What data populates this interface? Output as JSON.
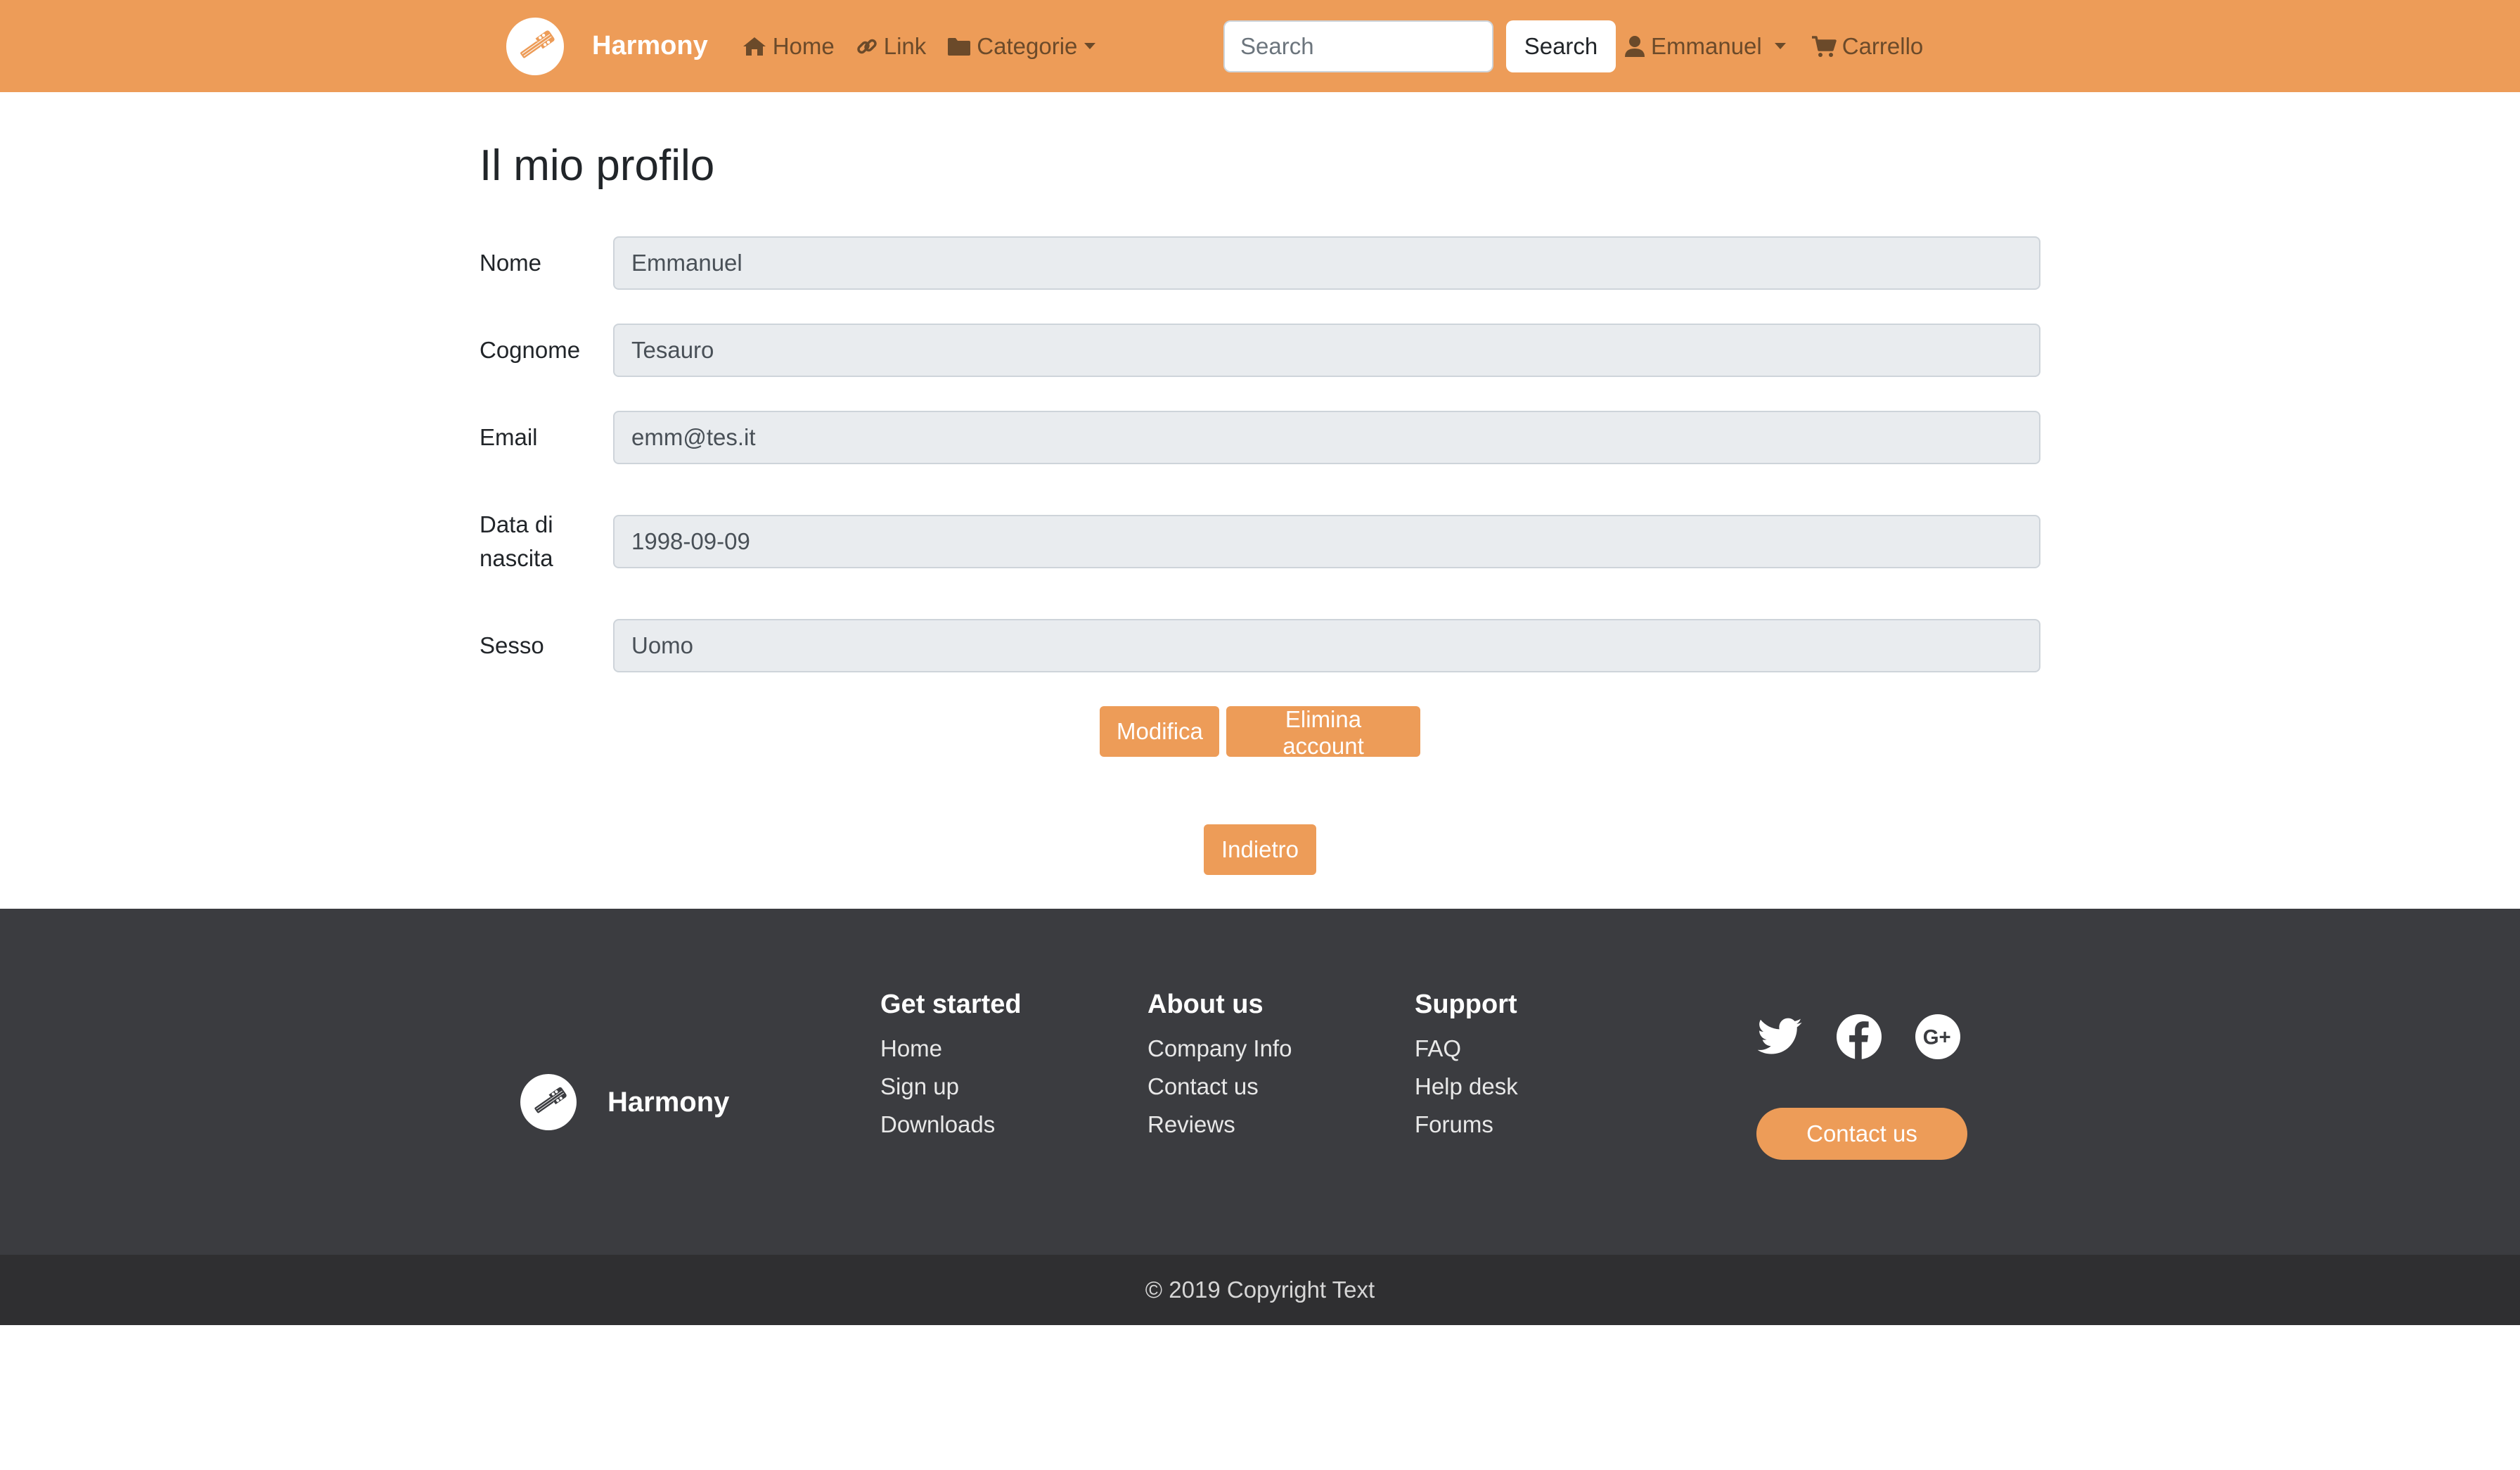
{
  "navbar": {
    "brand": "Harmony",
    "links": {
      "home": "Home",
      "link": "Link",
      "categories": "Categorie"
    },
    "search": {
      "placeholder": "Search",
      "button": "Search"
    },
    "user": "Emmanuel",
    "cart": "Carrello"
  },
  "profile": {
    "title": "Il mio profilo",
    "fields": {
      "nome": {
        "label": "Nome",
        "value": "Emmanuel"
      },
      "cognome": {
        "label": "Cognome",
        "value": "Tesauro"
      },
      "email": {
        "label": "Email",
        "value": "emm@tes.it"
      },
      "data_nascita": {
        "label": "Data di nascita",
        "value": "1998-09-09"
      },
      "sesso": {
        "label": "Sesso",
        "value": "Uomo"
      }
    },
    "buttons": {
      "edit": "Modifica",
      "delete": "Elimina account",
      "back": "Indietro"
    }
  },
  "footer": {
    "brand": "Harmony",
    "columns": {
      "get_started": {
        "title": "Get started",
        "links": [
          "Home",
          "Sign up",
          "Downloads"
        ]
      },
      "about": {
        "title": "About us",
        "links": [
          "Company Info",
          "Contact us",
          "Reviews"
        ]
      },
      "support": {
        "title": "Support",
        "links": [
          "FAQ",
          "Help desk",
          "Forums"
        ]
      }
    },
    "social_icons": [
      "twitter-icon",
      "facebook-icon",
      "google-plus-icon"
    ],
    "contact_button": "Contact us",
    "copyright": "© 2019 Copyright Text"
  },
  "colors": {
    "accent": "#ED9C58",
    "footer_bg": "#3b3c40",
    "footer_bottom_bg": "#2f2f31"
  }
}
